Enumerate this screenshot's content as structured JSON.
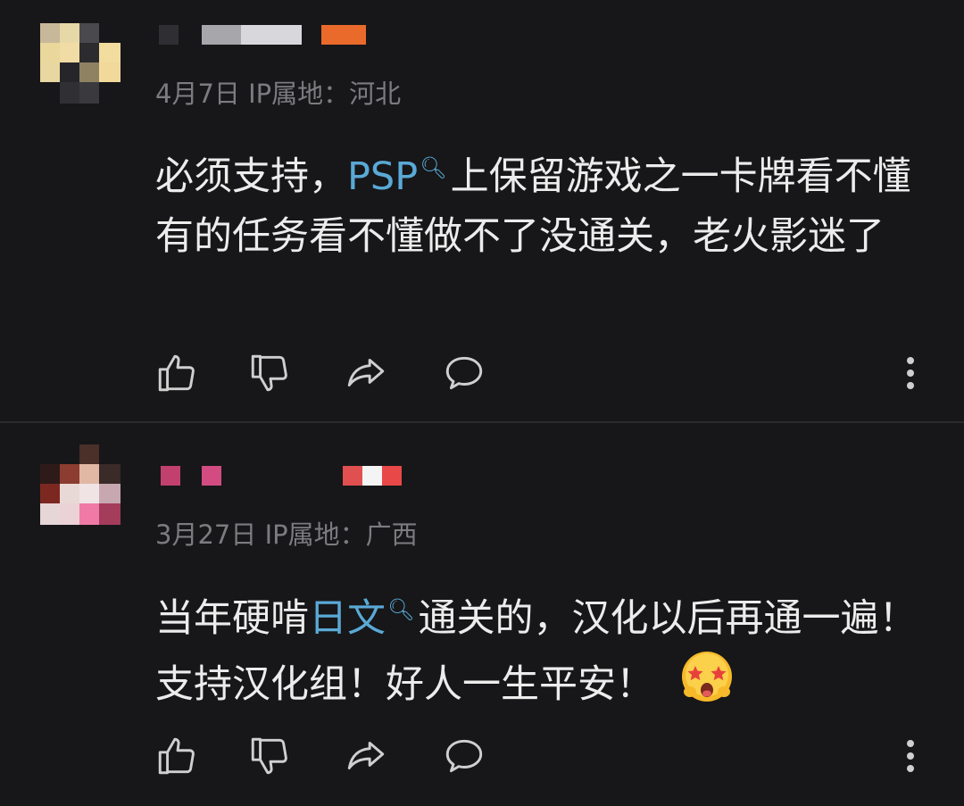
{
  "comments": [
    {
      "date": "4月7日",
      "ip_label": "IP属地：",
      "location": "河北",
      "text_before": "必须支持，",
      "keyword": "PSP",
      "text_after": "上保留游戏之一卡牌看不懂有的任务看不懂做不了没通关，老火影迷了",
      "has_emoji": false
    },
    {
      "date": "3月27日",
      "ip_label": "IP属地：",
      "location": "广西",
      "text_before": "当年硬啃",
      "keyword": "日文",
      "text_after": "通关的，汉化以后再通一遍！支持汉化组！好人一生平安！",
      "has_emoji": true,
      "emoji": "star-struck-face-icon"
    }
  ],
  "colors": {
    "background": "#171719",
    "text": "#ececec",
    "meta": "#7c7c80",
    "link": "#5aa9d6",
    "icon": "#cfcfcf"
  }
}
